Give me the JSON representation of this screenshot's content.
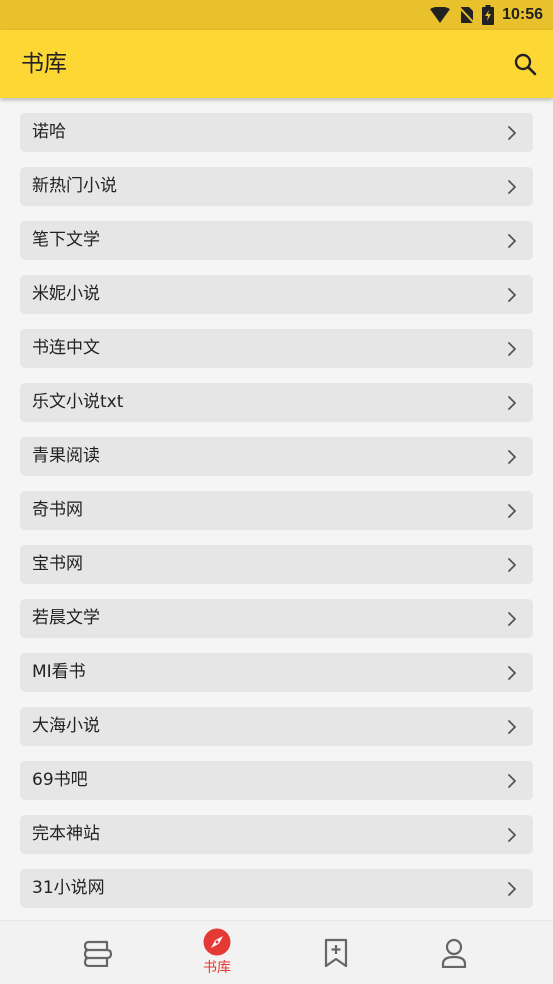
{
  "status_bar": {
    "time": "10:56"
  },
  "header": {
    "title": "书库"
  },
  "sources": [
    {
      "label": "诺哈"
    },
    {
      "label": "新热门小说"
    },
    {
      "label": "笔下文学"
    },
    {
      "label": "米妮小说"
    },
    {
      "label": "书连中文"
    },
    {
      "label": "乐文小说txt"
    },
    {
      "label": "青果阅读"
    },
    {
      "label": "奇书网"
    },
    {
      "label": "宝书网"
    },
    {
      "label": "若晨文学"
    },
    {
      "label": "MI看书"
    },
    {
      "label": "大海小说"
    },
    {
      "label": "69书吧"
    },
    {
      "label": "完本神站"
    },
    {
      "label": "31小说网"
    }
  ],
  "bottom_nav": {
    "active_label": "书库",
    "items": [
      {
        "icon": "bookshelf-icon"
      },
      {
        "icon": "compass-icon"
      },
      {
        "icon": "bookmark-add-icon"
      },
      {
        "icon": "person-icon"
      }
    ]
  },
  "colors": {
    "status_bar": "#e8c12c",
    "app_bar": "#fdd835",
    "row_bg": "#e6e6e6",
    "accent": "#e53935"
  }
}
